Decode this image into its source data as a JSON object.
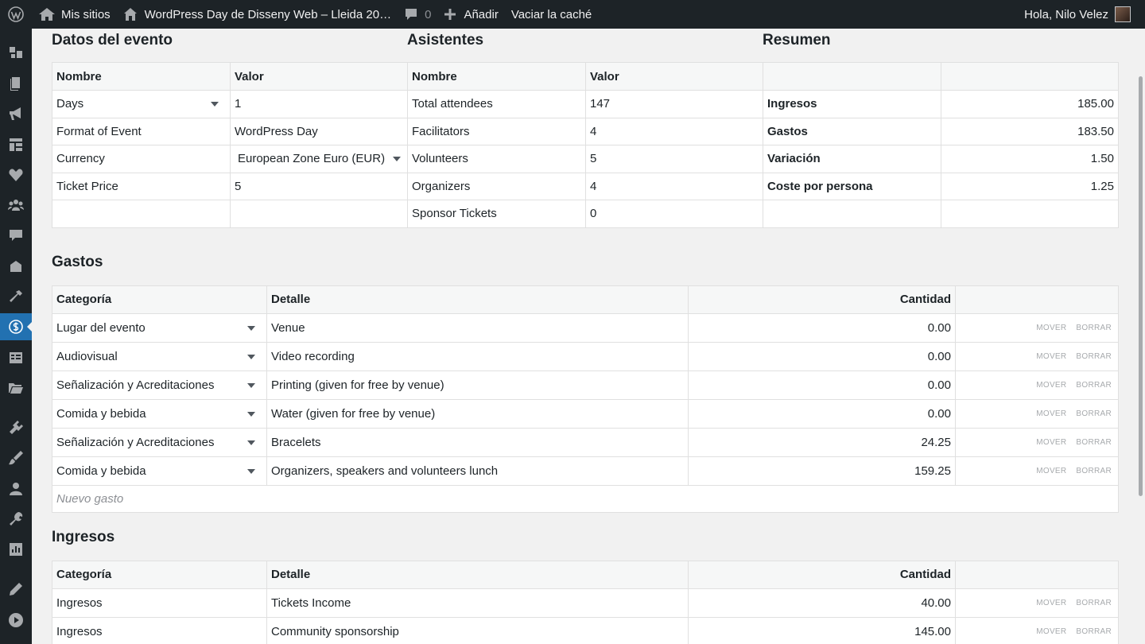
{
  "admin_bar": {
    "my_sites": "Mis sitios",
    "site_name": "WordPress Day de Disseny Web – Lleida 20…",
    "comments_count": "0",
    "new_label": "Añadir",
    "cache_label": "Vaciar la caché",
    "greeting": "Hola, Nilo Velez"
  },
  "event": {
    "title": "Datos del evento",
    "col_name": "Nombre",
    "col_value": "Valor",
    "rows": [
      {
        "name": "Days",
        "value": "1"
      },
      {
        "name": "Format of Event",
        "value": "WordPress Day"
      },
      {
        "name": "Currency",
        "value": "European Zone Euro (EUR)"
      },
      {
        "name": "Ticket Price",
        "value": "5"
      }
    ]
  },
  "attendees": {
    "title": "Asistentes",
    "col_name": "Nombre",
    "col_value": "Valor",
    "rows": [
      {
        "name": "Total attendees",
        "value": "147"
      },
      {
        "name": "Facilitators",
        "value": "4"
      },
      {
        "name": "Volunteers",
        "value": "5"
      },
      {
        "name": "Organizers",
        "value": "4"
      },
      {
        "name": "Sponsor Tickets",
        "value": "0"
      }
    ]
  },
  "summary": {
    "title": "Resumen",
    "rows": [
      {
        "label": "Ingresos",
        "value": "185.00"
      },
      {
        "label": "Gastos",
        "value": "183.50"
      },
      {
        "label": "Variación",
        "value": "1.50"
      },
      {
        "label": "Coste por persona",
        "value": "1.25"
      }
    ]
  },
  "expenses": {
    "title": "Gastos",
    "col_category": "Categoría",
    "col_detail": "Detalle",
    "col_amount": "Cantidad",
    "move_label": "MOVER",
    "delete_label": "BORRAR",
    "new_label": "Nuevo gasto",
    "rows": [
      {
        "category": "Lugar del evento",
        "detail": "Venue",
        "amount": "0.00"
      },
      {
        "category": "Audiovisual",
        "detail": "Video recording",
        "amount": "0.00"
      },
      {
        "category": "Señalización y Acreditaciones",
        "detail": "Printing (given for free by venue)",
        "amount": "0.00"
      },
      {
        "category": "Comida y bebida",
        "detail": "Water (given for free by venue)",
        "amount": "0.00"
      },
      {
        "category": "Señalización y Acreditaciones",
        "detail": "Bracelets",
        "amount": "24.25"
      },
      {
        "category": "Comida y bebida",
        "detail": "Organizers, speakers and volunteers lunch",
        "amount": "159.25"
      }
    ]
  },
  "income": {
    "title": "Ingresos",
    "col_category": "Categoría",
    "col_detail": "Detalle",
    "col_amount": "Cantidad",
    "move_label": "MOVER",
    "delete_label": "BORRAR",
    "rows": [
      {
        "category": "Ingresos",
        "detail": "Tickets Income",
        "amount": "40.00"
      },
      {
        "category": "Ingresos",
        "detail": "Community sponsorship",
        "amount": "145.00"
      }
    ]
  },
  "colors": {
    "admin_bar": "#1d2327",
    "accent": "#2271b1",
    "background": "#f1f1f1"
  },
  "icons": {
    "sidebar": [
      "dashboard-icon",
      "media-icon",
      "pages-icon",
      "megaphone-icon",
      "layout-icon",
      "heart-icon",
      "groups-icon",
      "comments-icon",
      "feedback-icon",
      "tools-icon",
      "budget-icon",
      "list-icon",
      "folder-icon",
      "plugins-icon",
      "appearance-icon",
      "users-icon",
      "settings-icon",
      "stats-icon",
      "edit-icon",
      "play-icon"
    ]
  }
}
